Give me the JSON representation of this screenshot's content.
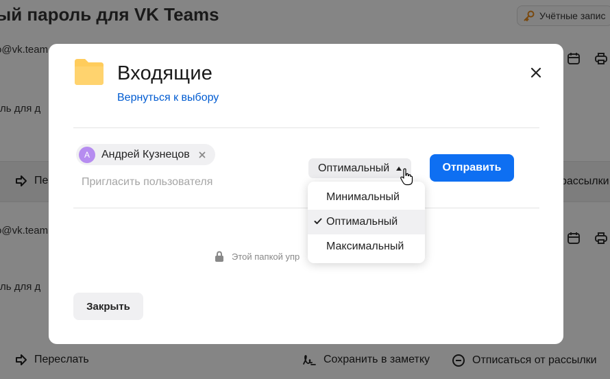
{
  "background": {
    "title_fragment": "ый пароль для VK Teams",
    "accounts_button": "Учётные запис",
    "email_fragment": "o@vk.team",
    "snippet_fragment": "оль для д",
    "forward_top_fragment": "Пе",
    "unsubscribe_top_fragment": "рассылки",
    "forward_label": "Переслать",
    "save_note_label": "Сохранить в заметку",
    "unsubscribe_label": "Отписаться от рассылки"
  },
  "modal": {
    "title": "Входящие",
    "back_link": "Вернуться к выбору",
    "recipient": {
      "initial": "А",
      "name": "Андрей Кузнецов"
    },
    "invite_placeholder": "Пригласить пользователя",
    "access_select": {
      "value": "Оптимальный",
      "options": [
        "Минимальный",
        "Оптимальный",
        "Максимальный"
      ],
      "selected_index": 1
    },
    "send_button": "Отправить",
    "note_text": "Этой папкой упр",
    "close_button": "Закрыть"
  },
  "colors": {
    "accent": "#0e6ff2",
    "link": "#005bd1",
    "folder": "#ffcc5c",
    "avatar": "#b68cf0"
  }
}
